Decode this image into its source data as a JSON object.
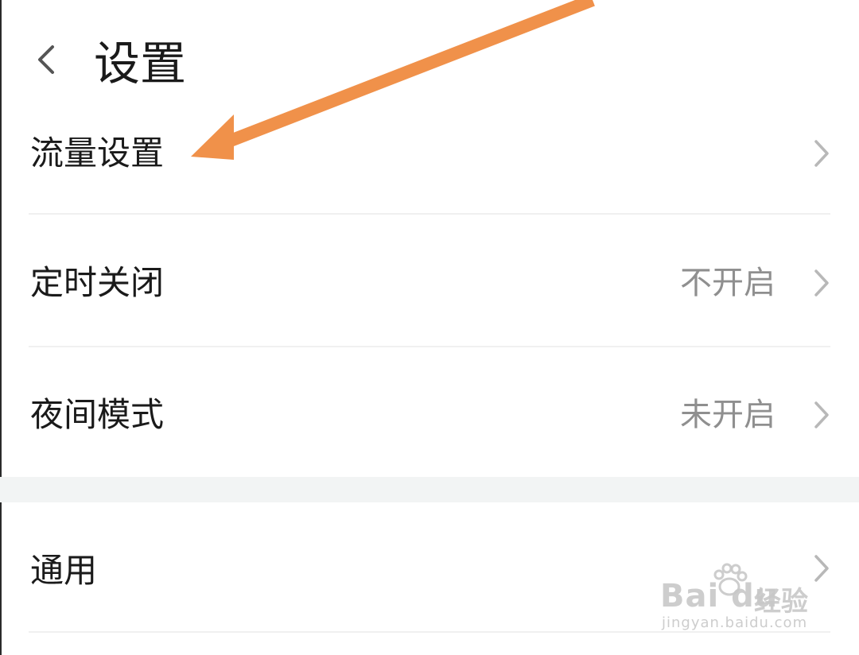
{
  "header": {
    "title": "设置",
    "back_icon": "chevron-left-icon"
  },
  "settings": {
    "items": [
      {
        "label": "流量设置",
        "value": "",
        "icon": "chevron-right-icon"
      },
      {
        "label": "定时关闭",
        "value": "不开启",
        "icon": "chevron-right-icon"
      },
      {
        "label": "夜间模式",
        "value": "未开启",
        "icon": "chevron-right-icon"
      },
      {
        "label": "通用",
        "value": "",
        "icon": "chevron-right-icon"
      }
    ]
  },
  "annotation": {
    "arrow_color": "#F0914A",
    "icon": "arrow-annotation-icon"
  },
  "watermark": {
    "brand": "Bai du",
    "sub": "经验",
    "url": "jingyan.baidu.com"
  },
  "colors": {
    "background": "#FFFFFF",
    "text": "#1A1A1A",
    "secondary_text": "#8F8F8F",
    "chevron": "#B8B8B8",
    "section_gap": "#F2F4F4"
  }
}
